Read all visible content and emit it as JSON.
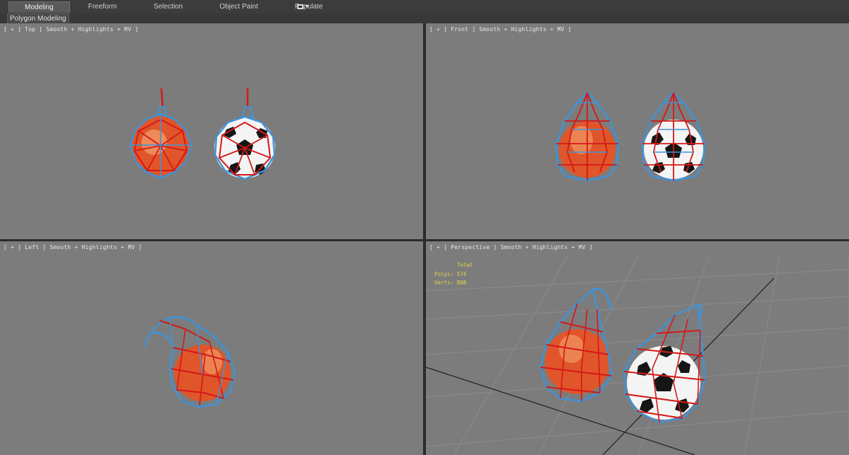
{
  "ribbon": {
    "tabs": [
      {
        "label": "Modeling",
        "active": true
      },
      {
        "label": "Freeform",
        "active": false
      },
      {
        "label": "Selection",
        "active": false
      },
      {
        "label": "Object Paint",
        "active": false
      },
      {
        "label": "Populate",
        "active": false
      }
    ]
  },
  "subbar": {
    "panel_label": "Polygon Modeling"
  },
  "viewports": {
    "top": {
      "label": "[ + ] Top ] Smooth + Highlights + MV ]"
    },
    "front": {
      "label": "[ + ] Front ] Smooth + Highlights + MV ]"
    },
    "left": {
      "label": "[ + ] Left ] Smooth + Highlights + MV ]"
    },
    "perspective": {
      "label": "[ + ] Perspective ] Smooth + Highlights + MV ]"
    }
  },
  "stats": {
    "total_label": "Total",
    "polys": "Polys: 574",
    "verts": "Verts: 808"
  },
  "colors": {
    "viewport_bg": "#7c7c7c",
    "net_red": "#d41818",
    "net_blue": "#3f93d8",
    "basketball": "#e0552a",
    "stats_yellow": "#e6d24a"
  }
}
